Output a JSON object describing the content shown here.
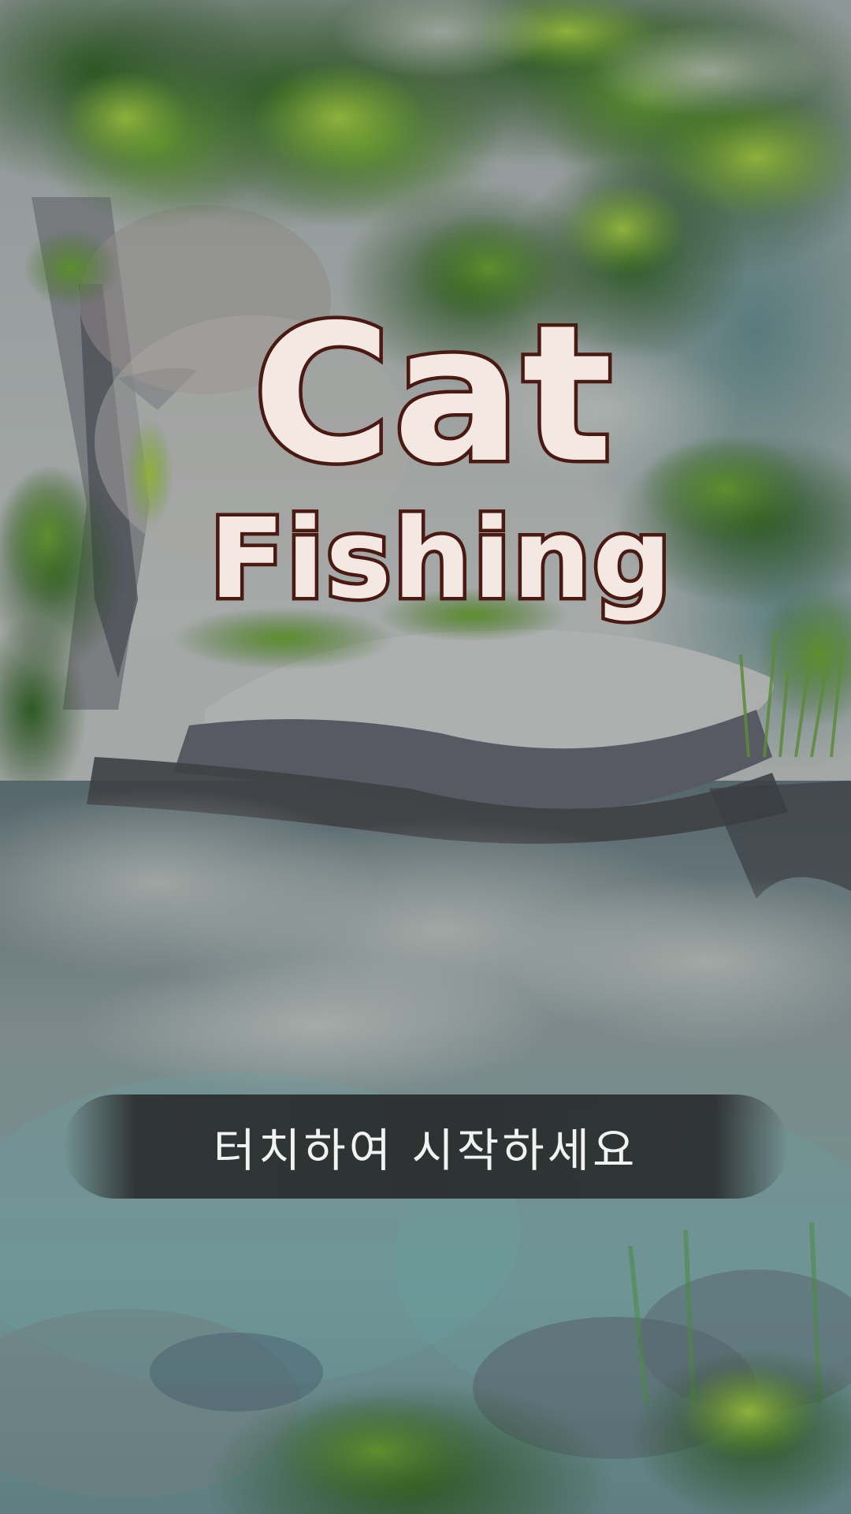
{
  "title": {
    "line1": "Cat",
    "line2": "Fishing"
  },
  "start_prompt": "터치하여 시작하세요",
  "colors": {
    "title_fill": "#f4e8e3",
    "title_outline": "#4a1a12",
    "banner_bg": "#2a2d2e",
    "banner_text": "#f2f2f0"
  },
  "scene": "forest-pond-background"
}
